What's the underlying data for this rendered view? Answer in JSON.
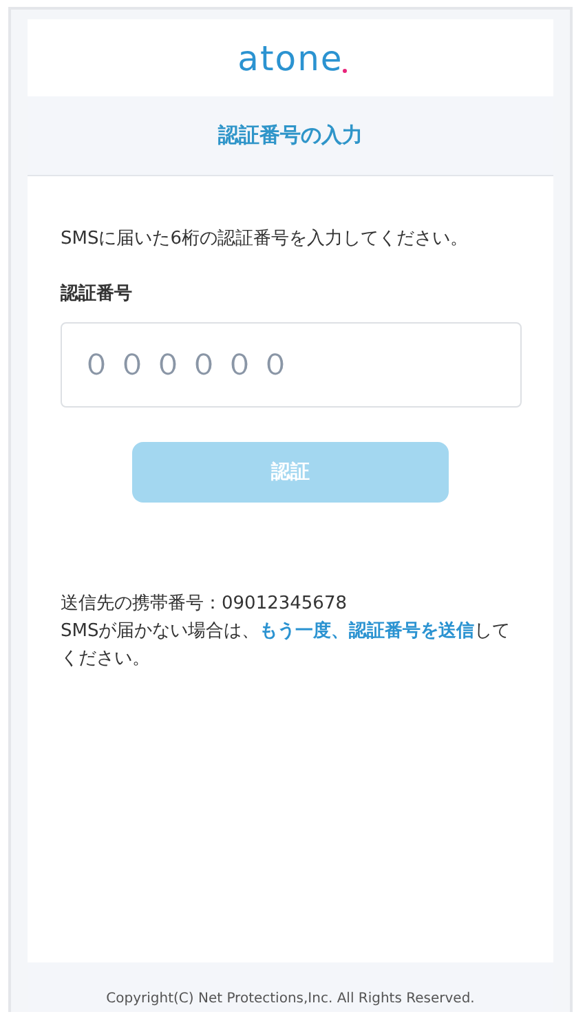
{
  "logo": "atone",
  "title": "認証番号の入力",
  "instruction": "SMSに届いた6桁の認証番号を入力してください。",
  "code_field": {
    "label": "認証番号",
    "placeholder": "００００００"
  },
  "submit": {
    "label": "認証",
    "disabled": true
  },
  "phone_line": "送信先の携帯番号：09012345678",
  "resend": {
    "before": "SMSが届かない場合は、",
    "link": "もう一度、認証番号を送信",
    "after": "してください。"
  },
  "footer": "Copyright(C) Net Protections,Inc. All Rights Reserved."
}
